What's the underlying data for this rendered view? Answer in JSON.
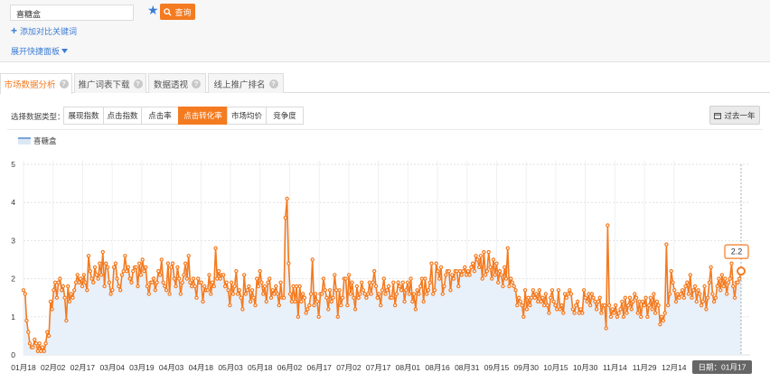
{
  "search": {
    "value": "喜糖盒",
    "button_label": "查询"
  },
  "add_compare_label": "添加对比关键词",
  "expand_panel_label": "展开快捷面板",
  "tabs": [
    {
      "label": "市场数据分析",
      "active": true
    },
    {
      "label": "推广词表下载",
      "active": false
    },
    {
      "label": "数据透视",
      "active": false
    },
    {
      "label": "线上推广排名",
      "active": false
    }
  ],
  "data_type_label": "选择数据类型：",
  "data_types": [
    {
      "label": "展现指数",
      "active": false
    },
    {
      "label": "点击指数",
      "active": false
    },
    {
      "label": "点击率",
      "active": false
    },
    {
      "label": "点击转化率",
      "active": true
    },
    {
      "label": "市场均价",
      "active": false
    },
    {
      "label": "竞争度",
      "active": false
    }
  ],
  "range_button_label": "过去一年",
  "colors": {
    "accent": "#f47b20",
    "link": "#3a7bd5",
    "area_fill": "#e8f0fa"
  },
  "icons": {
    "star": "star-icon",
    "search": "search-icon",
    "calendar": "calendar-icon"
  },
  "chart_data": {
    "type": "line",
    "series": [
      {
        "name": "喜糖盒",
        "values": [
          1.7,
          1.6,
          0.9,
          0.6,
          0.3,
          0.2,
          0.2,
          0.4,
          0.3,
          0.1,
          0.3,
          0.1,
          0.2,
          0.1,
          0.3,
          0.6,
          0.5,
          1.4,
          1.2,
          1.7,
          1.9,
          1.5,
          1.9,
          2.0,
          1.7,
          1.8,
          1.5,
          0.9,
          1.8,
          1.4,
          1.6,
          1.5,
          1.7,
          1.9,
          2.1,
          1.9,
          2.0,
          1.8,
          2.1,
          1.9,
          1.7,
          2.6,
          2.2,
          2.0,
          1.9,
          2.3,
          2.1,
          2.0,
          2.4,
          2.1,
          2.7,
          1.8,
          2.4,
          2.3,
          1.9,
          1.6,
          1.7,
          2.3,
          2.4,
          2.0,
          1.8,
          1.7,
          2.1,
          2.2,
          2.6,
          2.2,
          2.3,
          2.0,
          1.9,
          2.2,
          2.3,
          2.3,
          1.8,
          2.4,
          2.1,
          2.5,
          2.2,
          2.3,
          1.8,
          1.6,
          1.9,
          1.9,
          2.0,
          1.7,
          1.9,
          2.2,
          2.1,
          2.5,
          1.9,
          1.8,
          1.7,
          2.4,
          1.6,
          2.3,
          2.4,
          2.0,
          1.8,
          2.3,
          2.0,
          1.6,
          1.9,
          2.1,
          2.4,
          2.0,
          2.6,
          1.9,
          1.8,
          2.0,
          1.8,
          1.5,
          2.0,
          1.9,
          1.9,
          1.4,
          1.8,
          1.7,
          1.7,
          2.1,
          1.6,
          1.9,
          1.8,
          2.8,
          2.0,
          2.2,
          2.0,
          2.1,
          2.1,
          1.8,
          1.9,
          1.7,
          1.3,
          1.9,
          1.6,
          1.8,
          2.2,
          1.6,
          1.7,
          1.5,
          1.2,
          2.1,
          1.6,
          1.7,
          1.8,
          1.4,
          1.7,
          1.5,
          1.3,
          2.0,
          1.8,
          2.2,
          1.9,
          1.6,
          1.8,
          1.4,
          1.9,
          2.0,
          1.5,
          1.7,
          1.6,
          1.8,
          1.6,
          1.3,
          1.9,
          1.5,
          1.5,
          3.6,
          4.1,
          2.4,
          1.6,
          1.4,
          1.8,
          1.4,
          1.8,
          1.0,
          1.8,
          1.4,
          1.6,
          1.5,
          1.1,
          1.2,
          1.3,
          1.6,
          2.5,
          1.3,
          1.6,
          1.4,
          1.0,
          1.6,
          1.6,
          2.0,
          1.7,
          1.5,
          1.2,
          1.7,
          1.4,
          1.5,
          2.1,
          1.7,
          1.0,
          1.7,
          1.3,
          1.5,
          2.0,
          2.0,
          1.3,
          2.1,
          1.6,
          1.9,
          1.5,
          1.2,
          1.8,
          1.5,
          1.6,
          1.9,
          1.7,
          1.6,
          1.5,
          1.6,
          1.9,
          1.6,
          1.9,
          2.2,
          1.8,
          1.5,
          1.6,
          1.3,
          1.7,
          2.0,
          1.6,
          1.7,
          1.8,
          1.5,
          1.5,
          1.9,
          1.3,
          1.6,
          1.9,
          1.8,
          1.7,
          1.9,
          1.4,
          1.7,
          1.9,
          1.6,
          2.0,
          1.4,
          1.6,
          1.2,
          1.7,
          1.6,
          1.8,
          2.0,
          1.4,
          2.0,
          1.6,
          1.7,
          1.9,
          2.4,
          1.6,
          1.7,
          2.4,
          2.2,
          2.0,
          2.3,
          1.6,
          1.8,
          2.1,
          2.2,
          2.2,
          1.7,
          2.1,
          2.0,
          2.2,
          2.2,
          1.8,
          2.2,
          2.1,
          2.2,
          2.3,
          2.1,
          2.2,
          2.1,
          2.3,
          2.4,
          2.2,
          2.6,
          2.5,
          2.3,
          2.6,
          2.0,
          2.7,
          2.1,
          2.2,
          2.7,
          2.3,
          2.0,
          2.5,
          2.1,
          2.4,
          1.9,
          2.2,
          2.1,
          1.8,
          2.3,
          2.0,
          2.8,
          1.8,
          2.0,
          1.9,
          1.8,
          1.7,
          1.3,
          1.5,
          1.4,
          1.3,
          1.0,
          1.7,
          1.2,
          1.5,
          1.3,
          1.5,
          1.7,
          1.5,
          1.6,
          1.4,
          1.7,
          1.4,
          1.5,
          1.3,
          1.6,
          1.3,
          1.1,
          1.5,
          1.7,
          1.4,
          1.3,
          1.2,
          1.7,
          1.2,
          1.3,
          1.1,
          1.6,
          1.5,
          1.6,
          1.7,
          1.6,
          1.2,
          1.1,
          1.3,
          1.4,
          1.1,
          1.2,
          1.1,
          1.7,
          1.5,
          1.4,
          1.6,
          1.3,
          1.6,
          1.5,
          1.4,
          1.2,
          1.4,
          1.5,
          1.1,
          1.3,
          1.3,
          0.7,
          3.4,
          1.3,
          1.0,
          1.2,
          1.1,
          1.3,
          1.0,
          1.1,
          1.2,
          1.4,
          1.0,
          1.5,
          1.1,
          1.3,
          1.5,
          1.2,
          1.4,
          1.6,
          1.5,
          1.1,
          1.4,
          1.0,
          1.4,
          1.3,
          1.5,
          1.0,
          1.3,
          1.5,
          1.2,
          1.6,
          1.1,
          1.4,
          1.3,
          0.8,
          1.0,
          0.9,
          1.1,
          2.9,
          1.3,
          1.6,
          2.2,
          1.9,
          1.7,
          1.4,
          1.6,
          1.5,
          1.6,
          1.7,
          1.5,
          1.8,
          1.9,
          1.6,
          2.1,
          1.5,
          1.7,
          1.8,
          1.4,
          1.7,
          1.6,
          1.3,
          1.4,
          1.8,
          1.2,
          1.5,
          1.9,
          2.3,
          1.6,
          1.4,
          1.5,
          1.8,
          2.0,
          1.7,
          2.1,
          1.8,
          2.0,
          1.6,
          1.9,
          2.0,
          2.4,
          1.8,
          1.5,
          1.9,
          1.9,
          2.0,
          2.2
        ]
      }
    ],
    "x_tick_labels": [
      "01月18",
      "02月02",
      "02月17",
      "03月04",
      "03月19",
      "04月03",
      "04月18",
      "05月03",
      "05月18",
      "06月02",
      "06月17",
      "07月02",
      "07月17",
      "08月01",
      "08月16",
      "08月31",
      "09月15",
      "09月30",
      "10月15",
      "10月30",
      "11月14",
      "11月29",
      "12月14"
    ],
    "y_ticks": [
      0,
      1,
      2,
      3,
      4,
      5
    ],
    "ylim": [
      0,
      5
    ],
    "legend": "top-left",
    "grid": true,
    "last_value_label": "2.2",
    "date_badge": "日期：01月17"
  }
}
